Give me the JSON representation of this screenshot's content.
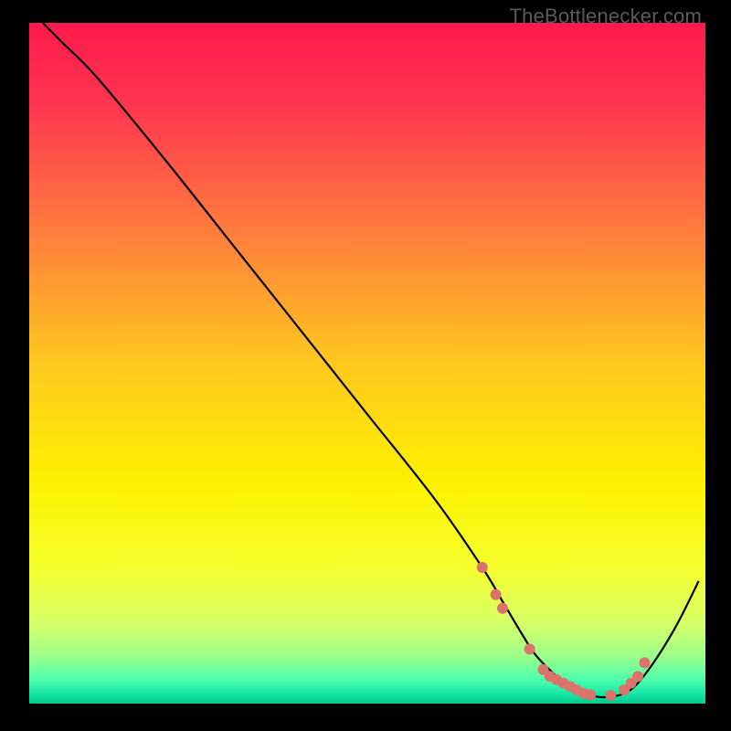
{
  "watermark": "TheBottlenecker.com",
  "chart_data": {
    "type": "line",
    "title": "",
    "xlabel": "",
    "ylabel": "",
    "xlim": [
      0,
      100
    ],
    "ylim": [
      0,
      100
    ],
    "grid": false,
    "series": [
      {
        "name": "curve",
        "color": "#000000",
        "x": [
          2,
          5,
          10,
          20,
          30,
          40,
          50,
          60,
          67,
          70,
          73,
          75,
          78,
          80,
          82,
          84,
          86,
          88,
          90,
          93,
          96,
          99
        ],
        "y": [
          100,
          97,
          92,
          80,
          67.5,
          55,
          42.5,
          30,
          20,
          15,
          10,
          7,
          4,
          2.5,
          1.5,
          1,
          1,
          1.5,
          3,
          7,
          12,
          18
        ]
      }
    ],
    "markers": {
      "name": "marker-dots",
      "color": "#d9736b",
      "radius": 6,
      "x": [
        67,
        69,
        70,
        74,
        76,
        77,
        78,
        79,
        80,
        81,
        82,
        83,
        86,
        88,
        89,
        90,
        91
      ],
      "y": [
        20,
        16,
        14,
        8,
        5,
        4,
        3.5,
        3,
        2.5,
        2,
        1.5,
        1.3,
        1.2,
        2,
        3,
        4,
        6
      ]
    },
    "background": {
      "type": "gradient",
      "stops": [
        {
          "offset": 0.0,
          "color": "#ff1a4d"
        },
        {
          "offset": 0.12,
          "color": "#ff3550"
        },
        {
          "offset": 0.3,
          "color": "#ff7a3e"
        },
        {
          "offset": 0.5,
          "color": "#ffc81f"
        },
        {
          "offset": 0.68,
          "color": "#fcf200"
        },
        {
          "offset": 0.8,
          "color": "#f5ff2e"
        },
        {
          "offset": 0.88,
          "color": "#d7ff66"
        },
        {
          "offset": 0.93,
          "color": "#9dff8a"
        },
        {
          "offset": 0.965,
          "color": "#4dffad"
        },
        {
          "offset": 0.985,
          "color": "#18e8a8"
        },
        {
          "offset": 1.0,
          "color": "#00c98e"
        }
      ]
    }
  }
}
